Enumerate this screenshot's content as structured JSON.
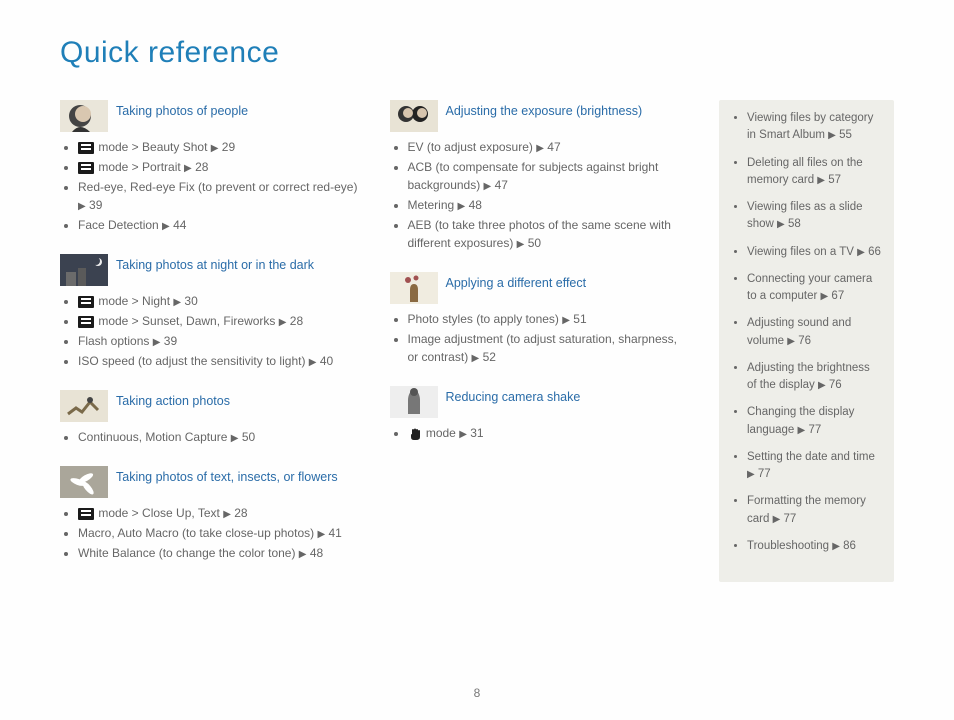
{
  "page_title": "Quick reference",
  "page_number": "8",
  "arrow": "▶",
  "col1": [
    {
      "title": "Taking photos of people",
      "thumb": "face",
      "items": [
        {
          "icon": "scene",
          "text": " mode > Beauty Shot ",
          "page": "29"
        },
        {
          "icon": "scene",
          "text": " mode > Portrait ",
          "page": "28"
        },
        {
          "text": "Red-eye, Red-eye Fix (to prevent or correct red-eye) ",
          "page": "39"
        },
        {
          "text": "Face Detection ",
          "page": "44"
        }
      ]
    },
    {
      "title": "Taking photos at night or in the dark",
      "thumb": "night",
      "items": [
        {
          "icon": "scene",
          "text": " mode > Night ",
          "page": "30"
        },
        {
          "icon": "scene",
          "text": " mode > Sunset, Dawn, Fireworks ",
          "page": "28"
        },
        {
          "text": "Flash options ",
          "page": "39"
        },
        {
          "text": "ISO speed (to adjust the sensitivity to light) ",
          "page": "40"
        }
      ]
    },
    {
      "title": "Taking action photos",
      "thumb": "action",
      "items": [
        {
          "text": "Continuous, Motion Capture ",
          "page": "50"
        }
      ]
    },
    {
      "title": "Taking photos of text, insects, or flowers",
      "thumb": "flower",
      "items": [
        {
          "icon": "scene",
          "text": " mode > Close Up, Text ",
          "page": "28"
        },
        {
          "text": "Macro, Auto Macro (to take close-up photos) ",
          "page": "41"
        },
        {
          "text": "White Balance (to change the color tone) ",
          "page": "48"
        }
      ]
    }
  ],
  "col2": [
    {
      "title": "Adjusting the exposure (brightness)",
      "thumb": "faces2",
      "items": [
        {
          "text": "EV (to adjust exposure) ",
          "page": "47"
        },
        {
          "text": "ACB (to compensate for subjects against bright backgrounds) ",
          "page": "47"
        },
        {
          "text": "Metering ",
          "page": "48"
        },
        {
          "text": "AEB (to take three photos of the same scene with different exposures) ",
          "page": "50"
        }
      ]
    },
    {
      "title": "Applying a different effect",
      "thumb": "vase",
      "items": [
        {
          "text": "Photo styles (to apply tones) ",
          "page": "51"
        },
        {
          "text": "Image adjustment (to adjust saturation, sharpness, or contrast) ",
          "page": "52"
        }
      ]
    },
    {
      "title": "Reducing camera shake",
      "thumb": "shake",
      "items": [
        {
          "icon": "hand",
          "text": " mode ",
          "page": "31"
        }
      ]
    }
  ],
  "sidebar": [
    {
      "text": "Viewing files by category in Smart Album ",
      "page": "55"
    },
    {
      "text": "Deleting all files on the memory card ",
      "page": "57"
    },
    {
      "text": "Viewing files as a slide show ",
      "page": "58"
    },
    {
      "text": "Viewing files on a TV ",
      "page": "66"
    },
    {
      "text": "Connecting your camera to a computer ",
      "page": "67"
    },
    {
      "text": "Adjusting sound and volume ",
      "page": "76"
    },
    {
      "text": "Adjusting the brightness of the display ",
      "page": "76"
    },
    {
      "text": "Changing the display language ",
      "page": "77"
    },
    {
      "text": "Setting the date and time ",
      "page": "77"
    },
    {
      "text": "Formatting the memory card ",
      "page": "77"
    },
    {
      "text": "Troubleshooting ",
      "page": "86"
    }
  ]
}
